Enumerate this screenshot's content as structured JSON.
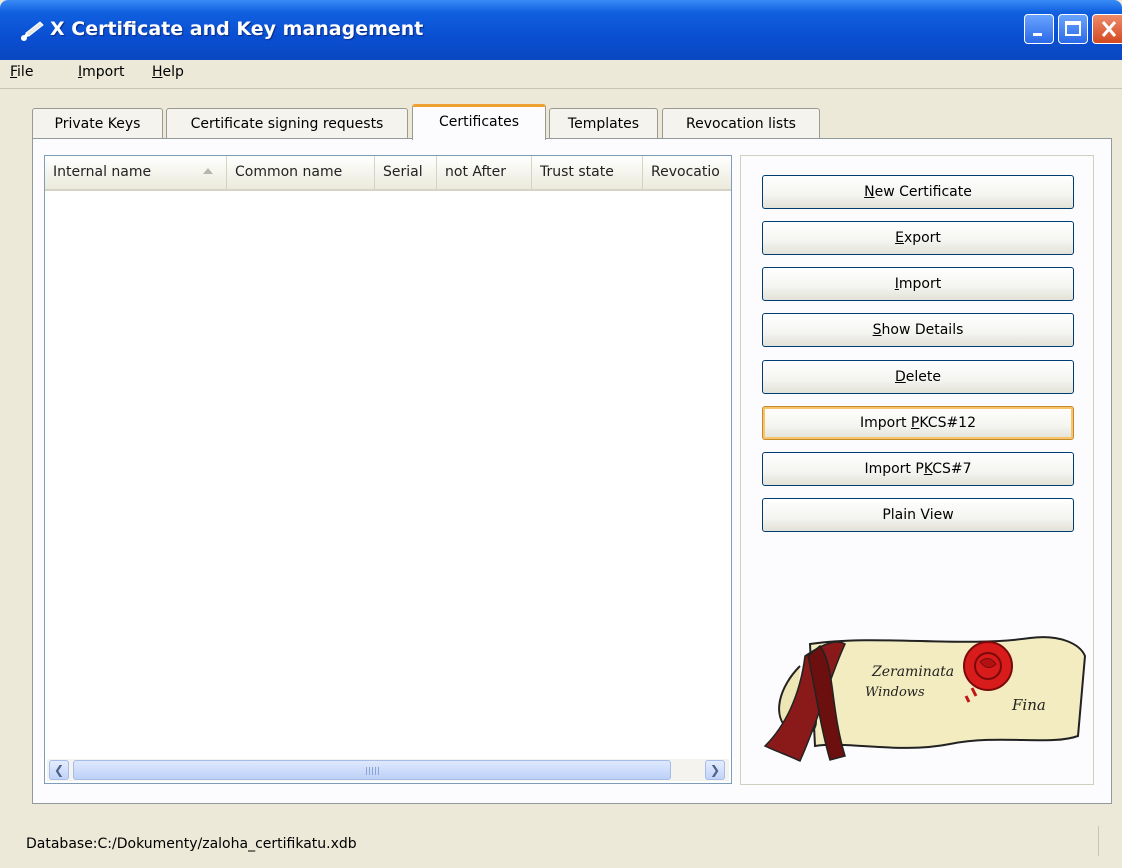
{
  "window": {
    "title": "X Certificate and Key management",
    "icon": "certificate-pen-icon"
  },
  "menu": [
    {
      "label": "File",
      "accel": "F",
      "rest": "ile"
    },
    {
      "label": "Import",
      "accel": "I",
      "rest": "mport"
    },
    {
      "label": "Help",
      "accel": "H",
      "rest": "elp"
    }
  ],
  "tabs": [
    {
      "label": "Private Keys"
    },
    {
      "label": "Certificate signing requests"
    },
    {
      "label": "Certificates",
      "active": true
    },
    {
      "label": "Templates"
    },
    {
      "label": "Revocation lists"
    }
  ],
  "table": {
    "columns": [
      "Internal name",
      "Common name",
      "Serial",
      "not After",
      "Trust state",
      "Revocatio"
    ],
    "sorted_column": "Internal name",
    "rows": []
  },
  "actions": [
    {
      "pre": "",
      "accel": "N",
      "post": "ew Certificate"
    },
    {
      "pre": "",
      "accel": "E",
      "post": "xport"
    },
    {
      "pre": "",
      "accel": "I",
      "post": "mport"
    },
    {
      "pre": "",
      "accel": "S",
      "post": "how Details"
    },
    {
      "pre": "",
      "accel": "D",
      "post": "elete"
    },
    {
      "pre": "Import ",
      "accel": "P",
      "post": "KCS#12"
    },
    {
      "pre": "Import P",
      "accel": "K",
      "post": "CS#7"
    },
    {
      "pre": "Plain View",
      "accel": "",
      "post": ""
    }
  ],
  "logo": {
    "text_line1": "Zeraminata",
    "text_line2": "Windows",
    "text_line3": "Fina"
  },
  "status": {
    "text": "Database:C:/Dokumenty/zaloha_certifikatu.xdb"
  },
  "colors": {
    "titlebar": "#0a4fd2",
    "active_tab_accent": "#f0a030",
    "hover_button_border": "#f8c46a"
  }
}
